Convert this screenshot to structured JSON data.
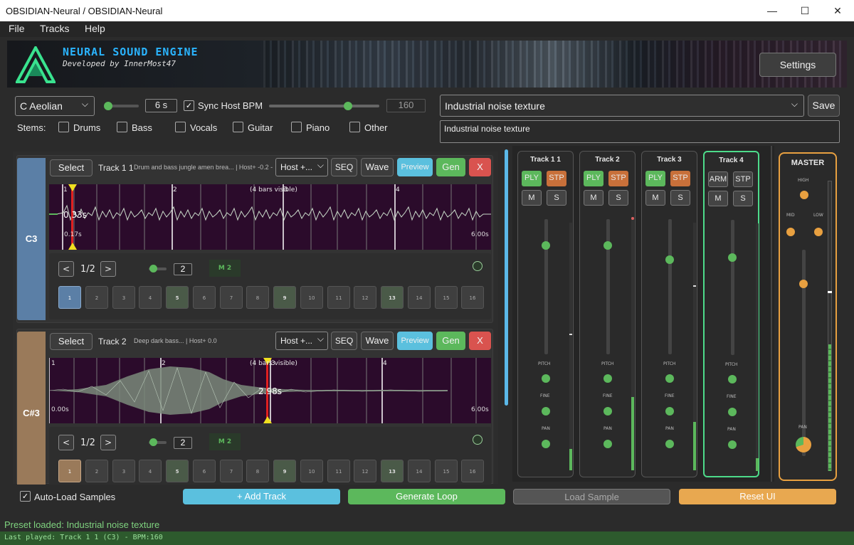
{
  "window": {
    "title": "OBSIDIAN-Neural / OBSIDIAN-Neural",
    "minimize": "—",
    "maximize": "☐",
    "close": "✕"
  },
  "menu": [
    "File",
    "Tracks",
    "Help"
  ],
  "banner": {
    "title": "NEURAL SOUND ENGINE",
    "subtitle": "Developed by InnerMost47",
    "settings_label": "Settings"
  },
  "controls": {
    "scale": "C Aeolian",
    "duration": "6 s",
    "duration_slider": 0.0,
    "sync_label": "Sync Host BPM",
    "sync_checked": true,
    "bpm": "160",
    "bpm_slider": 0.75,
    "preset": "Industrial noise texture",
    "prompt": "Industrial noise texture",
    "save_label": "Save",
    "stems_label": "Stems:",
    "stems": [
      "Drums",
      "Bass",
      "Vocals",
      "Guitar",
      "Piano",
      "Other"
    ]
  },
  "tracks": [
    {
      "key": "C3",
      "key_color": "#5b7fa6",
      "select": "Select",
      "name": "Track 1 1",
      "desc": "Drum and bass jungle amen brea... | Host+ -0.2 -",
      "host": "Host +...",
      "seq": "SEQ",
      "wave": "Wave",
      "preview": "Preview",
      "gen": "Gen",
      "remove": "X",
      "bars": [
        "1",
        "2",
        "3",
        "4"
      ],
      "visible": "(4 bars visible)",
      "cursor_time": "0.33s",
      "start_time": "0.17s",
      "end_time": "6.00s",
      "page": "1/2",
      "measure_count": "2",
      "measure_label": "M 2",
      "steps": [
        "1",
        "2",
        "3",
        "4",
        "5",
        "6",
        "7",
        "8",
        "9",
        "10",
        "11",
        "12",
        "13",
        "14",
        "15",
        "16"
      ]
    },
    {
      "key": "C#3",
      "key_color": "#9a7a5a",
      "select": "Select",
      "name": "Track 2",
      "desc": "Deep dark bass... | Host+ 0.0",
      "host": "Host +...",
      "seq": "SEQ",
      "wave": "Wave",
      "preview": "Preview",
      "gen": "Gen",
      "remove": "X",
      "bars": [
        "1",
        "2",
        "3",
        "4"
      ],
      "visible": "(4 bars visible)",
      "cursor_time": "2.98s",
      "start_time": "0.00s",
      "end_time": "6.00s",
      "page": "1/2",
      "measure_count": "2",
      "measure_label": "M 2",
      "steps": [
        "1",
        "2",
        "3",
        "4",
        "5",
        "6",
        "7",
        "8",
        "9",
        "10",
        "11",
        "12",
        "13",
        "14",
        "15",
        "16"
      ]
    }
  ],
  "mixer": {
    "channels": [
      {
        "name": "Track 1 1",
        "btn1": "PLY",
        "btn2": "STP",
        "mute": "M",
        "solo": "S",
        "fader": 0.9
      },
      {
        "name": "Track 2",
        "btn1": "PLY",
        "btn2": "STP",
        "mute": "M",
        "solo": "S",
        "fader": 0.9
      },
      {
        "name": "Track 3",
        "btn1": "PLY",
        "btn2": "STP",
        "mute": "M",
        "solo": "S",
        "fader": 0.75
      },
      {
        "name": "Track 4",
        "btn1": "ARM",
        "btn2": "STP",
        "mute": "M",
        "solo": "S",
        "fader": 0.75
      }
    ],
    "labels": {
      "pitch": "PITCH",
      "fine": "FINE",
      "pan": "PAN"
    },
    "master": {
      "name": "MASTER",
      "high": "HIGH",
      "mid": "MID",
      "low": "LOW",
      "pan": "PAN",
      "fader": 0.8
    }
  },
  "bottom": {
    "autoload": "Auto-Load Samples",
    "add_track": "+ Add Track",
    "generate": "Generate Loop",
    "load": "Load Sample",
    "reset": "Reset UI"
  },
  "status": {
    "line1": "Preset loaded: Industrial noise texture",
    "line2": "Last played: Track 1 1 (C3) - BPM:160"
  },
  "colors": {
    "accent_green": "#5cb85c",
    "preview_blue": "#5bc0de",
    "remove_red": "#d9534f",
    "stop_orange": "#c8703a",
    "master_orange": "#e8a040",
    "track4_border": "#4ddb8a"
  }
}
